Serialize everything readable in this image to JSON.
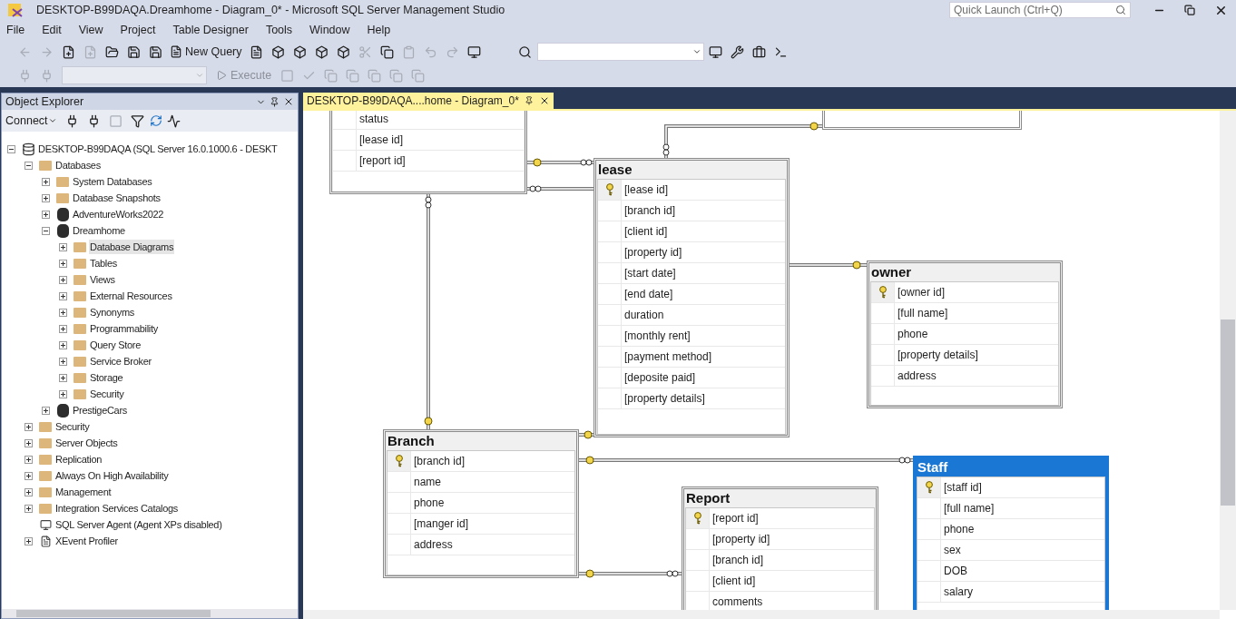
{
  "window": {
    "title": "DESKTOP-B99DAQA.Dreamhome - Diagram_0* - Microsoft SQL Server Management Studio"
  },
  "quick_launch": {
    "placeholder": "Quick Launch (Ctrl+Q)"
  },
  "menu": [
    "File",
    "Edit",
    "View",
    "Project",
    "Table Designer",
    "Tools",
    "Window",
    "Help"
  ],
  "toolbar": {
    "new_query": "New Query",
    "execute": {
      "label": "Execute",
      "disabled": true
    }
  },
  "object_explorer": {
    "title": "Object Explorer",
    "connect": "Connect",
    "tree": [
      {
        "label": "DESKTOP-B99DAQA (SQL Server 16.0.1000.6 - DESKT",
        "kind": "server",
        "expanded": true,
        "selected": false,
        "children": [
          {
            "label": "Databases",
            "kind": "folder",
            "expanded": true,
            "selected": false,
            "children": [
              {
                "label": "System Databases",
                "kind": "folder",
                "expanded": false,
                "selected": false
              },
              {
                "label": "Database Snapshots",
                "kind": "folder",
                "expanded": false,
                "selected": false
              },
              {
                "label": "AdventureWorks2022",
                "kind": "database",
                "expanded": false,
                "selected": false
              },
              {
                "label": "Dreamhome",
                "kind": "database",
                "expanded": true,
                "selected": false,
                "children": [
                  {
                    "label": "Database Diagrams",
                    "kind": "folder",
                    "expanded": false,
                    "selected": true
                  },
                  {
                    "label": "Tables",
                    "kind": "folder",
                    "expanded": false,
                    "selected": false
                  },
                  {
                    "label": "Views",
                    "kind": "folder",
                    "expanded": false,
                    "selected": false
                  },
                  {
                    "label": "External Resources",
                    "kind": "folder",
                    "expanded": false,
                    "selected": false
                  },
                  {
                    "label": "Synonyms",
                    "kind": "folder",
                    "expanded": false,
                    "selected": false
                  },
                  {
                    "label": "Programmability",
                    "kind": "folder",
                    "expanded": false,
                    "selected": false
                  },
                  {
                    "label": "Query Store",
                    "kind": "folder",
                    "expanded": false,
                    "selected": false
                  },
                  {
                    "label": "Service Broker",
                    "kind": "folder",
                    "expanded": false,
                    "selected": false
                  },
                  {
                    "label": "Storage",
                    "kind": "folder",
                    "expanded": false,
                    "selected": false
                  },
                  {
                    "label": "Security",
                    "kind": "folder",
                    "expanded": false,
                    "selected": false
                  }
                ]
              },
              {
                "label": "PrestigeCars",
                "kind": "database",
                "expanded": false,
                "selected": false
              }
            ]
          },
          {
            "label": "Security",
            "kind": "folder",
            "expanded": false,
            "selected": false
          },
          {
            "label": "Server Objects",
            "kind": "folder",
            "expanded": false,
            "selected": false
          },
          {
            "label": "Replication",
            "kind": "folder",
            "expanded": false,
            "selected": false
          },
          {
            "label": "Always On High Availability",
            "kind": "folder",
            "expanded": false,
            "selected": false
          },
          {
            "label": "Management",
            "kind": "folder",
            "expanded": false,
            "selected": false
          },
          {
            "label": "Integration Services Catalogs",
            "kind": "folder",
            "expanded": false,
            "selected": false
          },
          {
            "label": "SQL Server Agent (Agent XPs disabled)",
            "kind": "agent",
            "selected": false
          },
          {
            "label": "XEvent Profiler",
            "kind": "profiler",
            "expanded": false,
            "selected": false
          }
        ]
      }
    ]
  },
  "document_tab": {
    "title": "DESKTOP-B99DAQA....home - Diagram_0*",
    "selected": true
  },
  "diagram": {
    "tables": [
      {
        "selected": false,
        "columns": [
          {
            "name": "status",
            "key": false
          },
          {
            "name": "[lease id]",
            "key": false
          },
          {
            "name": "[report id]",
            "key": false
          }
        ]
      },
      {
        "name": "lease",
        "selected": false,
        "columns": [
          {
            "name": "[lease id]",
            "key": true
          },
          {
            "name": "[branch id]",
            "key": false
          },
          {
            "name": "[client id]",
            "key": false
          },
          {
            "name": "[property id]",
            "key": false
          },
          {
            "name": "[start date]",
            "key": false
          },
          {
            "name": "[end date]",
            "key": false
          },
          {
            "name": "duration",
            "key": false
          },
          {
            "name": "[monthly rent]",
            "key": false
          },
          {
            "name": "[payment method]",
            "key": false
          },
          {
            "name": "[deposite paid]",
            "key": false
          },
          {
            "name": "[property details]",
            "key": false
          }
        ]
      },
      {
        "name": "owner",
        "selected": false,
        "columns": [
          {
            "name": "[owner id]",
            "key": true
          },
          {
            "name": "[full name]",
            "key": false
          },
          {
            "name": "phone",
            "key": false
          },
          {
            "name": "[property details]",
            "key": false
          },
          {
            "name": "address",
            "key": false
          }
        ]
      },
      {
        "name": "Branch",
        "selected": false,
        "columns": [
          {
            "name": "[branch id]",
            "key": true
          },
          {
            "name": "name",
            "key": false
          },
          {
            "name": "phone",
            "key": false
          },
          {
            "name": "[manger id]",
            "key": false
          },
          {
            "name": "address",
            "key": false
          }
        ]
      },
      {
        "name": "Report",
        "selected": false,
        "columns": [
          {
            "name": "[report id]",
            "key": true
          },
          {
            "name": "[property id]",
            "key": false
          },
          {
            "name": "[branch id]",
            "key": false
          },
          {
            "name": "[client id]",
            "key": false
          },
          {
            "name": "comments",
            "key": false
          }
        ]
      },
      {
        "name": "Staff",
        "selected": true,
        "columns": [
          {
            "name": "[staff   id]",
            "key": true
          },
          {
            "name": "[full name]",
            "key": false
          },
          {
            "name": "phone",
            "key": false
          },
          {
            "name": "sex",
            "key": false
          },
          {
            "name": "DOB",
            "key": false
          },
          {
            "name": "salary",
            "key": false
          }
        ]
      }
    ]
  }
}
